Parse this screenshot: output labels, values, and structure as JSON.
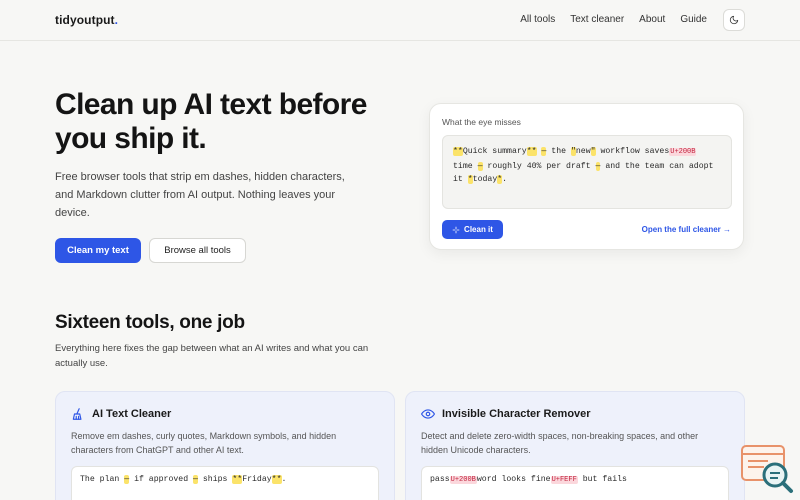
{
  "header": {
    "logo": "tidyoutput",
    "logo_dot": ".",
    "nav": [
      "All tools",
      "Text cleaner",
      "About",
      "Guide"
    ]
  },
  "hero": {
    "title": "Clean up AI text before you ship it.",
    "subtitle": "Free browser tools that strip em dashes, hidden characters, and Markdown clutter from AI output. Nothing leaves your device.",
    "primary_button": "Clean my text",
    "secondary_button": "Browse all tools"
  },
  "demo": {
    "label": "What the eye misses",
    "parts": {
      "p1": "**",
      "p2": "Quick summary",
      "p3": "**",
      "p4": " ",
      "p5": "—",
      "p6": " the ",
      "p7": "\"",
      "p8": "new",
      "p9": "\"",
      "p10": " workflow saves",
      "p11": "U+200B",
      "p12": "time ",
      "p13": "—",
      "p14": " roughly 40% per draft ",
      "p15": "—",
      "p16": " and the team can adopt it ",
      "p17": "*",
      "p18": "today",
      "p19": "*",
      "p20": "."
    },
    "clean_button": "Clean it",
    "full_link": "Open the full cleaner →"
  },
  "section": {
    "title": "Sixteen tools, one job",
    "subtitle": "Everything here fixes the gap between what an AI writes and what you can actually use."
  },
  "tools": [
    {
      "title": "AI Text Cleaner",
      "desc": "Remove em dashes, curly quotes, Markdown symbols, and hidden characters from ChatGPT and other AI text.",
      "sample": {
        "a": "The plan ",
        "b": "—",
        "c": " if approved ",
        "d": "—",
        "e": " ships ",
        "f": "**",
        "g": "Friday",
        "h": "**",
        "i": "."
      }
    },
    {
      "title": "Invisible Character Remover",
      "desc": "Detect and delete zero-width spaces, non-breaking spaces, and other hidden Unicode characters.",
      "sample": {
        "a": "pass",
        "b": "U+200B",
        "c": "word looks fine",
        "d": "U+FEFF",
        "e": " but fails"
      }
    }
  ],
  "colors": {
    "accent": "#2e56e6",
    "highlight": "#fbe36a",
    "code_bg": "#fbd7dc",
    "code_fg": "#c2243f",
    "card_bg": "#eef1fb"
  },
  "icons": [
    "moon-icon",
    "sparkle-icon",
    "broom-icon",
    "eye-icon",
    "search-doc-icon"
  ]
}
